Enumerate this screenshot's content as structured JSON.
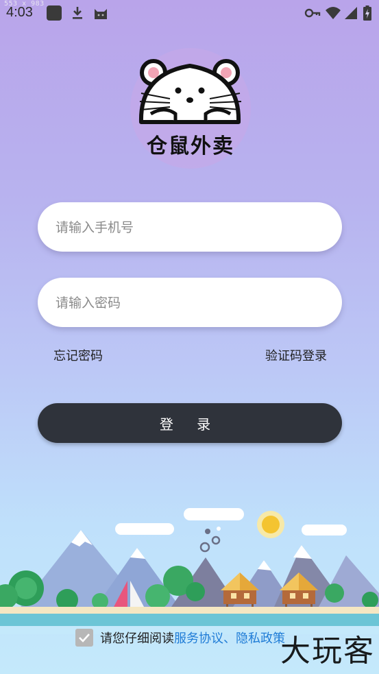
{
  "overlay": {
    "dimensions": "553 x 983"
  },
  "status_bar": {
    "time": "4:03",
    "icons": [
      "app-square-icon",
      "download-icon",
      "cat-icon",
      "vpn-key-icon",
      "wifi-icon",
      "signal-icon",
      "battery-icon"
    ]
  },
  "logo": {
    "text": "仓鼠外卖",
    "icon": "hamster-icon"
  },
  "form": {
    "phone_placeholder": "请输入手机号",
    "phone_value": "",
    "password_placeholder": "请输入密码",
    "password_value": "",
    "forgot_label": "忘记密码",
    "sms_login_label": "验证码登录",
    "login_label": "登 录"
  },
  "agreement": {
    "prefix": "请您仔细阅读",
    "service": "服务协议",
    "separator": "、",
    "privacy": "隐私政策",
    "checked": true
  },
  "watermark": "大玩客",
  "colors": {
    "accent_dark": "#2f333b",
    "link": "#1f7cd6"
  }
}
